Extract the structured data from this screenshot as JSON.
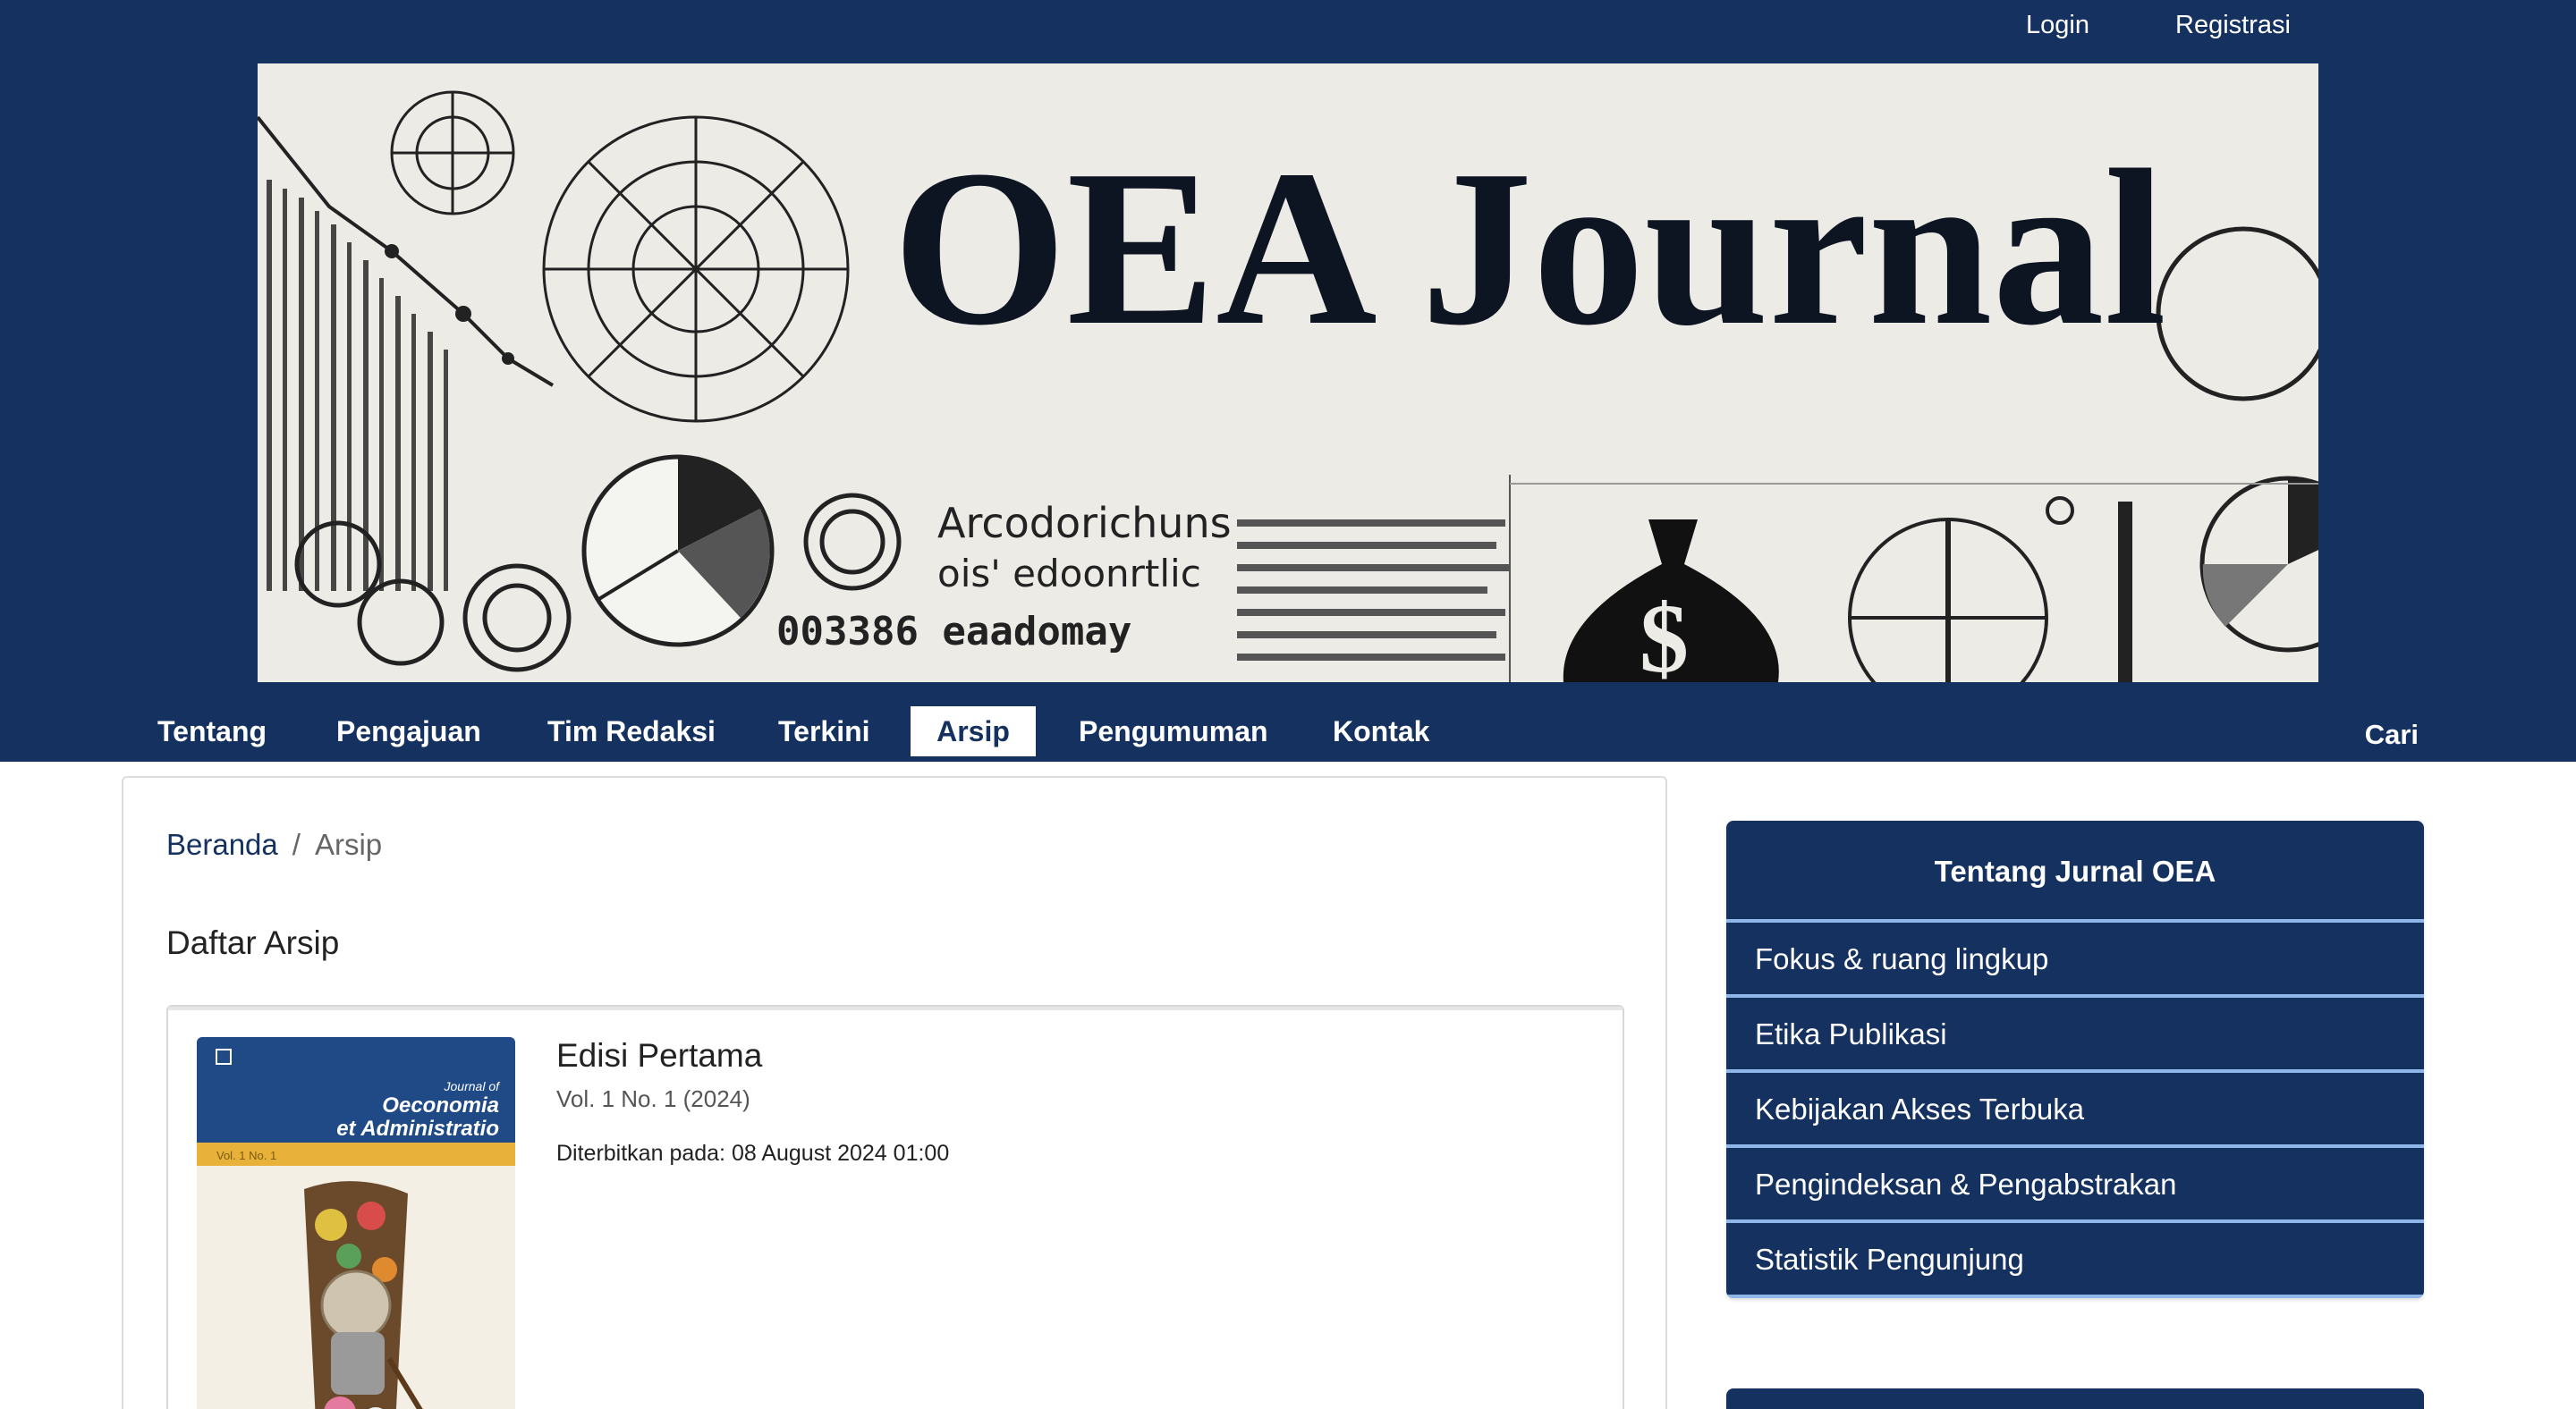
{
  "user_nav": {
    "login": "Login",
    "register": "Registrasi"
  },
  "banner": {
    "title": "OEA Journal",
    "text_lines": [
      "Arcodorichuns",
      "ois' edoonrtlic",
      "003386 eaadomay"
    ]
  },
  "primary_nav": {
    "items": [
      {
        "label": "Tentang",
        "active": false
      },
      {
        "label": "Pengajuan",
        "active": false
      },
      {
        "label": "Tim Redaksi",
        "active": false
      },
      {
        "label": "Terkini",
        "active": false
      },
      {
        "label": "Arsip",
        "active": true
      },
      {
        "label": "Pengumuman",
        "active": false
      },
      {
        "label": "Kontak",
        "active": false
      }
    ],
    "search": "Cari"
  },
  "breadcrumb": {
    "home": "Beranda",
    "separator": "/",
    "current": "Arsip"
  },
  "page_title": "Daftar Arsip",
  "issue": {
    "title": "Edisi Pertama",
    "series": "Vol. 1 No. 1 (2024)",
    "published": "Diterbitkan pada: 08 August 2024 01:00",
    "cover": {
      "journal_of": "Journal of",
      "name_line1": "Oeconomia",
      "name_line2": "et Administratio",
      "volume": "Vol. 1 No. 1"
    }
  },
  "sidebar": {
    "title": "Tentang Jurnal OEA",
    "links": [
      "Fokus & ruang lingkup",
      "Etika Publikasi",
      "Kebijakan Akses Terbuka",
      "Pengindeksan & Pengabstrakan",
      "Statistik Pengunjung"
    ]
  },
  "colors": {
    "brand_navy": "#14315f",
    "sidebar_divider": "#8fb6e8",
    "cover_gold": "#e8b23a"
  }
}
